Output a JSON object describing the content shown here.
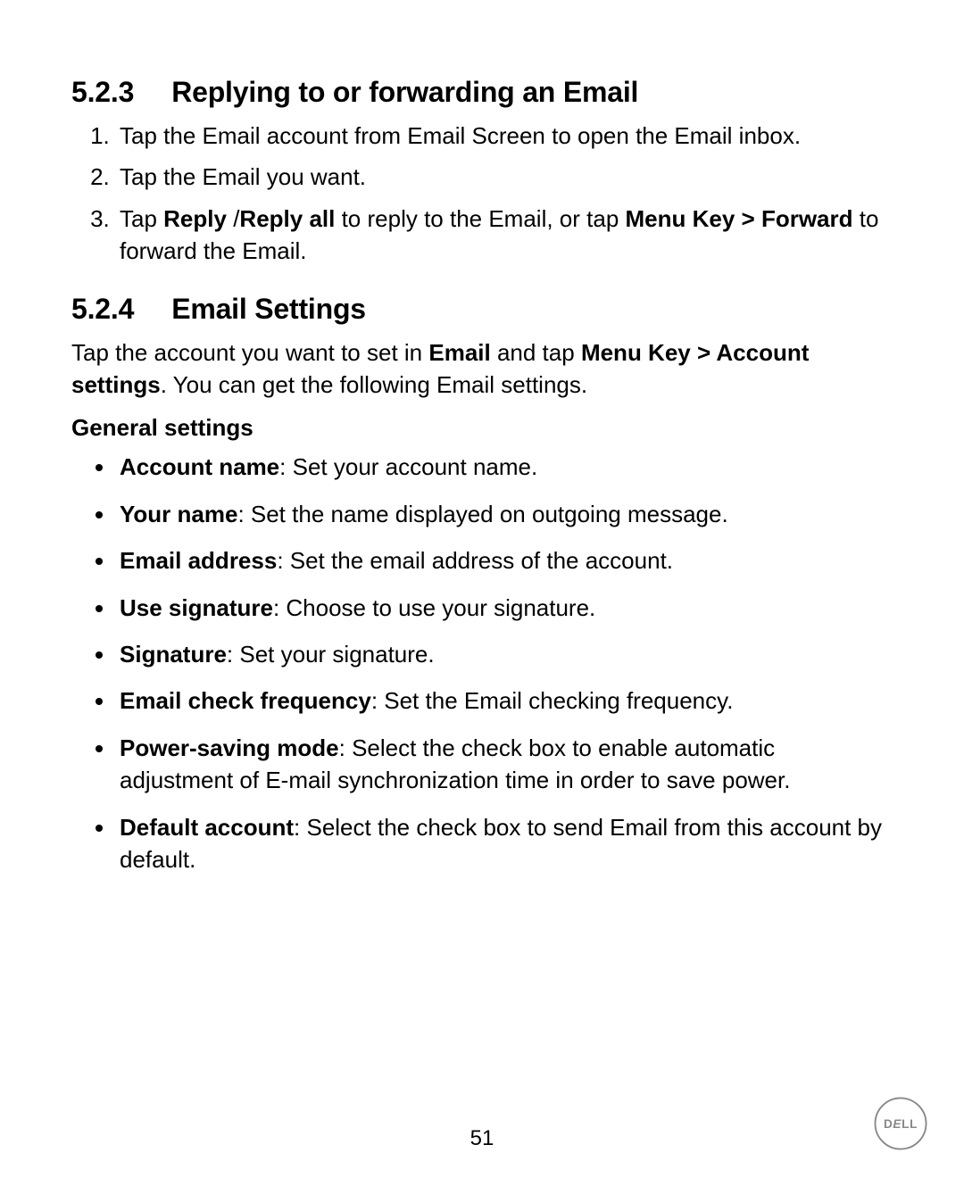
{
  "section1": {
    "number": "5.2.3",
    "title": "Replying to or forwarding an Email",
    "steps": [
      {
        "text": "Tap the Email account from Email Screen to open the Email inbox."
      },
      {
        "text": "Tap the Email you want."
      },
      {
        "pre": "Tap ",
        "b1": "Reply ",
        "mid1": "/",
        "b2": "Reply all",
        "mid2": " to reply to the Email, or tap ",
        "b3": "Menu Key > Forward",
        "post": " to forward the Email."
      }
    ]
  },
  "section2": {
    "number": "5.2.4",
    "title": "Email Settings",
    "intro": {
      "pre": "Tap the account you want to set in ",
      "b1": "Email",
      "mid1": " and tap ",
      "b2": "Menu Key > Account settings",
      "post": ". You can get the following Email settings."
    },
    "subhead": "General settings",
    "bullets": [
      {
        "label": "Account name",
        "desc": ": Set your account name."
      },
      {
        "label": "Your name",
        "desc": ": Set the name displayed on outgoing message."
      },
      {
        "label": "Email address",
        "desc": ": Set the email address of the account."
      },
      {
        "label": "Use signature",
        "desc": ": Choose to use your signature."
      },
      {
        "label": "Signature",
        "desc": ": Set your signature."
      },
      {
        "label": "Email check frequency",
        "desc": ": Set the Email checking frequency."
      },
      {
        "label": "Power-saving mode",
        "desc": ": Select the check box to enable automatic adjustment of E-mail synchronization time in order to save power."
      },
      {
        "label": "Default account",
        "desc": ": Select the check box to send Email from this account by default."
      }
    ]
  },
  "pageNumber": "51",
  "logoText": "DELL"
}
